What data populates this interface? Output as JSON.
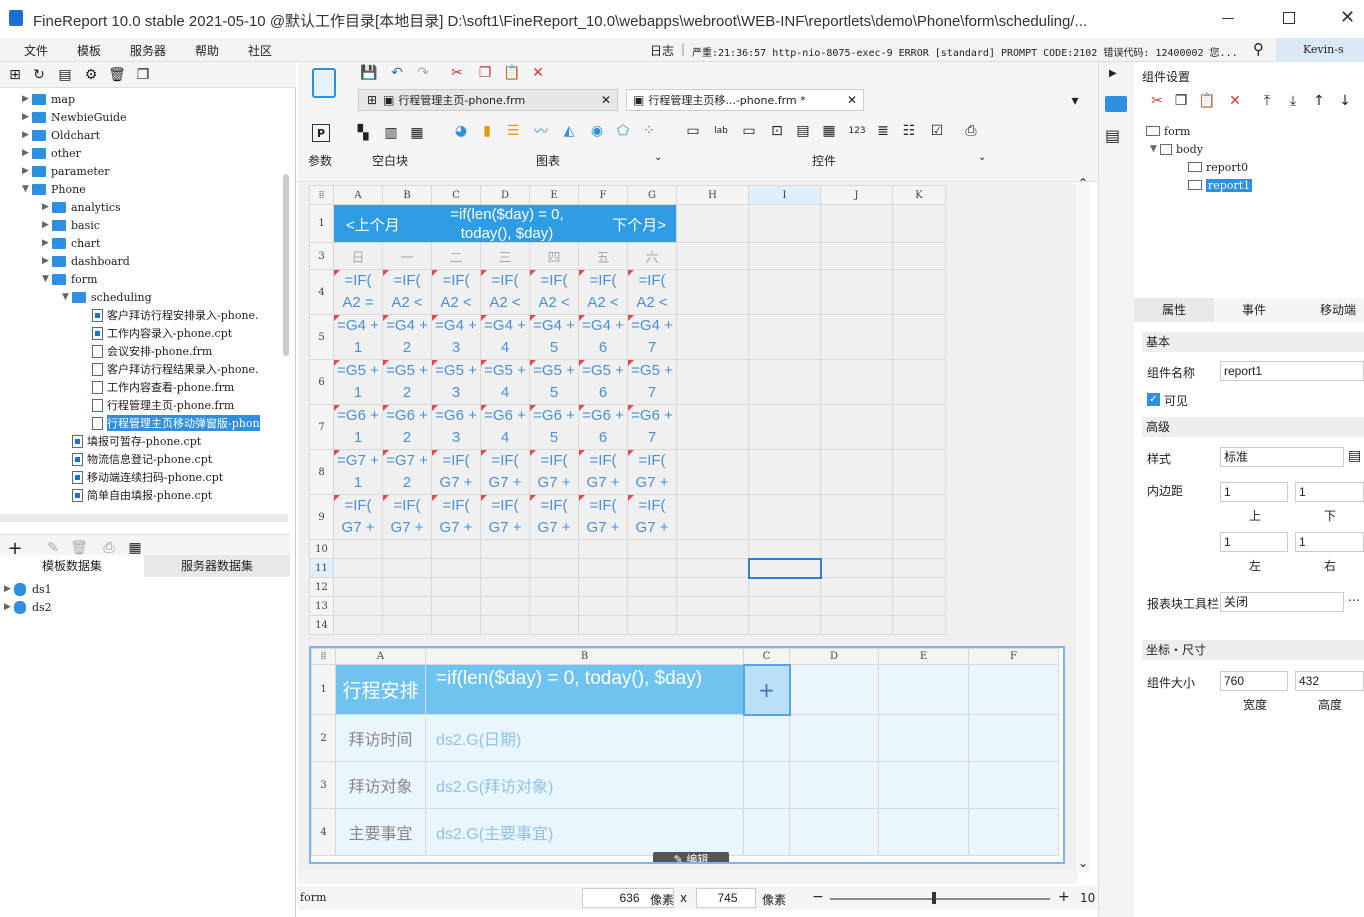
{
  "window": {
    "title": "FineReport 10.0 stable 2021-05-10 @默认工作目录[本地目录]    D:\\soft1\\FineReport_10.0\\webapps\\webroot\\WEB-INF\\reportlets\\demo\\Phone\\form\\scheduling/..."
  },
  "menu": [
    "文件",
    "模板",
    "服务器",
    "帮助",
    "社区"
  ],
  "log": {
    "label": "日志",
    "text": "严重:21:36:57 http-nio-8075-exec-9 ERROR [standard] PROMPT CODE:2102 错误代码: 12400002 您...",
    "user": "Kevin-s"
  },
  "tree": [
    {
      "label": "map",
      "type": "folder",
      "level": 1,
      "arrow": "▶"
    },
    {
      "label": "NewbieGuide",
      "type": "folder",
      "level": 1,
      "arrow": "▶"
    },
    {
      "label": "Oldchart",
      "type": "folder",
      "level": 1,
      "arrow": "▶"
    },
    {
      "label": "other",
      "type": "folder",
      "level": 1,
      "arrow": "▶"
    },
    {
      "label": "parameter",
      "type": "folder",
      "level": 1,
      "arrow": "▶"
    },
    {
      "label": "Phone",
      "type": "folder",
      "level": 1,
      "arrow": "▼"
    },
    {
      "label": "analytics",
      "type": "folder",
      "level": 2,
      "arrow": "▶"
    },
    {
      "label": "basic",
      "type": "folder",
      "level": 2,
      "arrow": "▶"
    },
    {
      "label": "chart",
      "type": "folder",
      "level": 2,
      "arrow": "▶"
    },
    {
      "label": "dashboard",
      "type": "folder",
      "level": 2,
      "arrow": "▶"
    },
    {
      "label": "form",
      "type": "folder",
      "level": 2,
      "arrow": "▼"
    },
    {
      "label": "scheduling",
      "type": "folder",
      "level": 3,
      "arrow": "▼"
    },
    {
      "label": "客户拜访行程安排录入-phone.",
      "type": "cpt",
      "level": 4,
      "arrow": ""
    },
    {
      "label": "工作内容录入-phone.cpt",
      "type": "cpt",
      "level": 4,
      "arrow": ""
    },
    {
      "label": "会议安排-phone.frm",
      "type": "frm",
      "level": 4,
      "arrow": ""
    },
    {
      "label": "客户拜访行程结果录入-phone.",
      "type": "frm",
      "level": 4,
      "arrow": ""
    },
    {
      "label": "工作内容查看-phone.frm",
      "type": "frm",
      "level": 4,
      "arrow": ""
    },
    {
      "label": "行程管理主页-phone.frm",
      "type": "frm",
      "level": 4,
      "arrow": ""
    },
    {
      "label": "行程管理主页移动弹窗版-phon",
      "type": "frm",
      "level": 4,
      "arrow": "",
      "selected": true
    },
    {
      "label": "填报可暂存-phone.cpt",
      "type": "cpt",
      "level": 3,
      "arrow": ""
    },
    {
      "label": "物流信息登记-phone.cpt",
      "type": "cpt",
      "level": 3,
      "arrow": ""
    },
    {
      "label": "移动端连续扫码-phone.cpt",
      "type": "cpt",
      "level": 3,
      "arrow": ""
    },
    {
      "label": "简单自由填报-phone.cpt",
      "type": "cpt",
      "level": 3,
      "arrow": ""
    }
  ],
  "dataset_tabs": [
    "模板数据集",
    "服务器数据集"
  ],
  "datasets": [
    "ds1",
    "ds2"
  ],
  "tabs": [
    {
      "label": "行程管理主页-phone.frm",
      "active": false
    },
    {
      "label": "行程管理主页移...-phone.frm *",
      "active": true
    }
  ],
  "toolbar_groups": [
    "参数",
    "空白块",
    "图表",
    "控件"
  ],
  "report0": {
    "cols": [
      "A",
      "B",
      "C",
      "D",
      "E",
      "F",
      "G",
      "H",
      "I",
      "J",
      "K"
    ],
    "rows": [
      "1",
      "3",
      "4",
      "5",
      "6",
      "7",
      "8",
      "9",
      "10",
      "11",
      "12",
      "13",
      "14"
    ],
    "banner": {
      "left": "<上个月",
      "center": "=if(len($day) = 0, today(), $day)",
      "right": "下个月>"
    },
    "weekdays": [
      "日",
      "一",
      "二",
      "三",
      "四",
      "五",
      "六"
    ],
    "r4": [
      "=IF( A2 =",
      "=IF( A2 <",
      "=IF( A2 <",
      "=IF( A2 <",
      "=IF( A2 <",
      "=IF( A2 <",
      "=IF( A2 <"
    ],
    "r5": [
      "=G4 + 1",
      "=G4 + 2",
      "=G4 + 3",
      "=G4 + 4",
      "=G4 + 5",
      "=G4 + 6",
      "=G4 + 7"
    ],
    "r6": [
      "=G5 + 1",
      "=G5 + 2",
      "=G5 + 3",
      "=G5 + 4",
      "=G5 + 5",
      "=G5 + 6",
      "=G5 + 7"
    ],
    "r7": [
      "=G6 + 1",
      "=G6 + 2",
      "=G6 + 3",
      "=G6 + 4",
      "=G6 + 5",
      "=G6 + 6",
      "=G6 + 7"
    ],
    "r8": [
      "=G7 + 1",
      "=G7 + 2",
      "=IF( G7 +",
      "=IF( G7 +",
      "=IF( G7 +",
      "=IF( G7 +",
      "=IF( G7 +"
    ],
    "r9": [
      "=IF( G7 +",
      "=IF( G7 +",
      "=IF( G7 +",
      "=IF( G7 +",
      "=IF( G7 +",
      "=IF( G7 +",
      "=IF( G7 +"
    ]
  },
  "report1": {
    "cols": [
      "A",
      "B",
      "C",
      "D",
      "E",
      "F"
    ],
    "title": "行程安排",
    "title_formula": "=if(len($day) = 0, today(), $day)",
    "plus": "+",
    "rows": [
      {
        "num": "2",
        "label": "拜访时间",
        "value": "ds2.G(日期)"
      },
      {
        "num": "3",
        "label": "拜访对象",
        "value": "ds2.G(拜访对象)"
      },
      {
        "num": "4",
        "label": "主要事宜",
        "value": "ds2.G(主要事宜)"
      }
    ],
    "edit_label": "编辑"
  },
  "statusbar": {
    "form": "form",
    "width": "636",
    "unit1": "像素",
    "x": "x",
    "height": "745",
    "unit2": "像素",
    "zoom": "10"
  },
  "right": {
    "title": "组件设置",
    "tree": [
      "form",
      "body",
      "report0",
      "report1"
    ],
    "tabs": [
      "属性",
      "事件",
      "移动端"
    ],
    "basic": "基本",
    "name_label": "组件名称",
    "name_value": "report1",
    "visible_label": "可见",
    "advanced": "高级",
    "style_label": "样式",
    "style_value": "标准",
    "padding_label": "内边距",
    "pad_top": "1",
    "pad_bottom": "1",
    "pad_left": "1",
    "pad_right": "1",
    "top": "上",
    "bottom": "下",
    "left": "左",
    "right": "右",
    "toolbar_label": "报表块工具栏",
    "toolbar_value": "关闭",
    "coord": "坐标・尺寸",
    "size_label": "组件大小",
    "w_value": "760",
    "h_value": "432",
    "w_label": "宽度",
    "h_label": "高度"
  }
}
